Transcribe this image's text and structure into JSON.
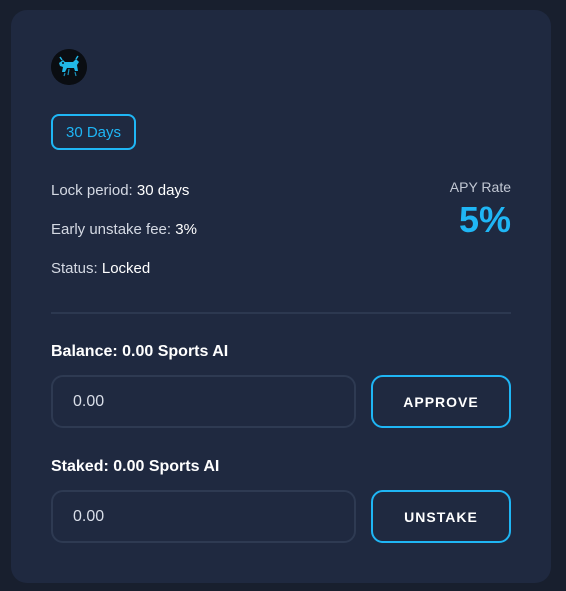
{
  "pool": {
    "logo_icon": "bull-logo-icon",
    "period_badge": "30 Days",
    "lock_period_label": "Lock period:",
    "lock_period_value": "30 days",
    "fee_label": "Early unstake fee:",
    "fee_value": "3%",
    "status_label": "Status:",
    "status_value": "Locked",
    "apy_label": "APY Rate",
    "apy_value": "5%"
  },
  "balance": {
    "label": "Balance: 0.00 Sports AI",
    "input_value": "0.00",
    "button_label": "APPROVE"
  },
  "staked": {
    "label": "Staked: 0.00 Sports AI",
    "input_value": "0.00",
    "button_label": "UNSTAKE"
  },
  "colors": {
    "accent": "#1fb6f5",
    "card_bg": "#1f2940",
    "page_bg": "#181f2e"
  }
}
